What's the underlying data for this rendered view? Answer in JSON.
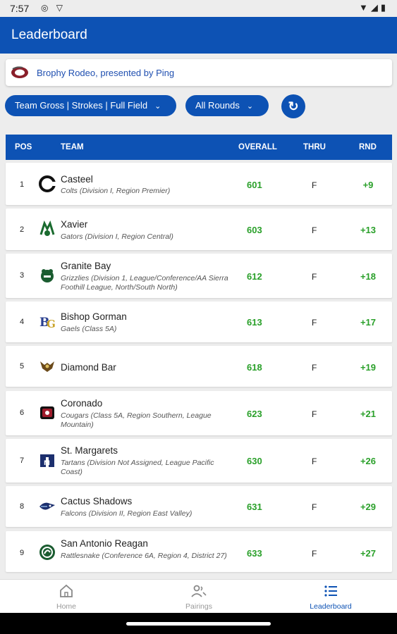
{
  "status_bar": {
    "time": "7:57"
  },
  "app_bar": {
    "title": "Leaderboard"
  },
  "event": {
    "name": "Brophy Rodeo, presented by Ping"
  },
  "filters": {
    "team_filter": "Team Gross | Strokes | Full Field",
    "rounds_filter": "All Rounds"
  },
  "table": {
    "headers": {
      "pos": "POS",
      "team": "TEAM",
      "overall": "OVERALL",
      "thru": "THRU",
      "rnd": "RND"
    },
    "rows": [
      {
        "pos": "1",
        "name": "Casteel",
        "sub": "Colts (Division I, Region Premier)",
        "overall": "601",
        "thru": "F",
        "rnd": "+9"
      },
      {
        "pos": "2",
        "name": "Xavier",
        "sub": "Gators (Division I, Region Central)",
        "overall": "603",
        "thru": "F",
        "rnd": "+13"
      },
      {
        "pos": "3",
        "name": "Granite Bay",
        "sub": "Grizzlies (Division 1, League/Conference/AA Sierra Foothill League, North/South North)",
        "overall": "612",
        "thru": "F",
        "rnd": "+18"
      },
      {
        "pos": "4",
        "name": "Bishop Gorman",
        "sub": "Gaels (Class 5A)",
        "overall": "613",
        "thru": "F",
        "rnd": "+17"
      },
      {
        "pos": "5",
        "name": "Diamond Bar",
        "sub": "",
        "overall": "618",
        "thru": "F",
        "rnd": "+19"
      },
      {
        "pos": "6",
        "name": "Coronado",
        "sub": "Cougars (Class 5A, Region Southern, League Mountain)",
        "overall": "623",
        "thru": "F",
        "rnd": "+21"
      },
      {
        "pos": "7",
        "name": "St. Margarets",
        "sub": "Tartans (Division Not Assigned, League Pacific Coast)",
        "overall": "630",
        "thru": "F",
        "rnd": "+26"
      },
      {
        "pos": "8",
        "name": "Cactus Shadows",
        "sub": "Falcons (Division II, Region East Valley)",
        "overall": "631",
        "thru": "F",
        "rnd": "+29"
      },
      {
        "pos": "9",
        "name": "San Antonio Reagan",
        "sub": "Rattlesnake (Conference 6A, Region 4, District 27)",
        "overall": "633",
        "thru": "F",
        "rnd": "+27"
      }
    ]
  },
  "bottom_nav": {
    "home": "Home",
    "pairings": "Pairings",
    "leaderboard": "Leaderboard"
  },
  "colors": {
    "primary": "#0d52b4",
    "score_green": "#2aa02a",
    "background": "#ededed"
  }
}
